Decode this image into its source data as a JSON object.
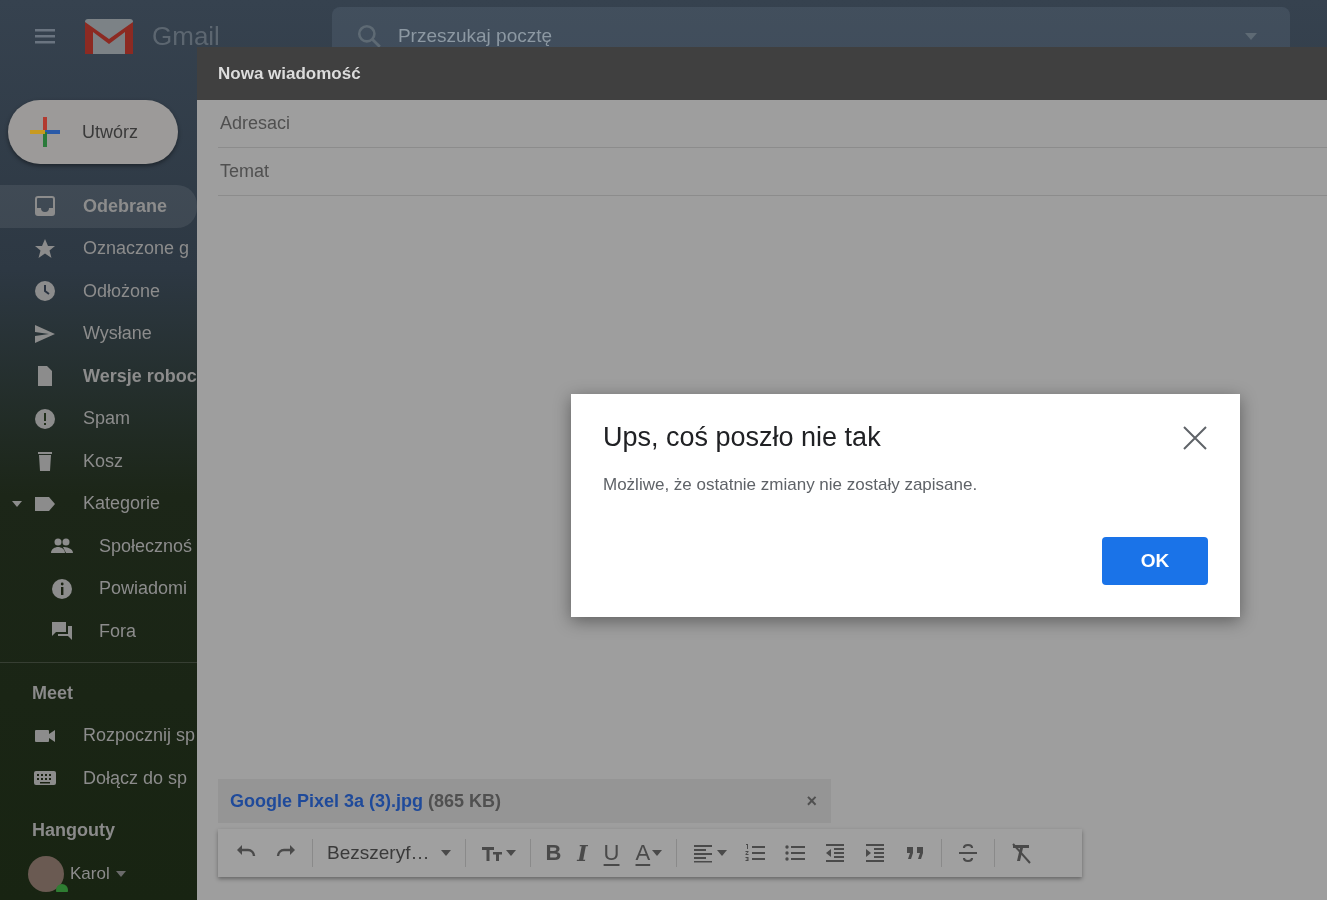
{
  "topbar": {
    "app_name": "Gmail",
    "search": {
      "placeholder": "Przeszukaj pocztę"
    }
  },
  "compose_button": {
    "label": "Utwórz"
  },
  "sidebar": {
    "items": [
      {
        "label": "Odebrane",
        "selected": true,
        "unread": true
      },
      {
        "label": "Oznaczone g",
        "selected": false,
        "unread": false
      },
      {
        "label": "Odłożone",
        "selected": false,
        "unread": false
      },
      {
        "label": "Wysłane",
        "selected": false,
        "unread": false
      },
      {
        "label": "Wersje roboc",
        "selected": false,
        "unread": true
      },
      {
        "label": "Spam",
        "selected": false,
        "unread": false
      },
      {
        "label": "Kosz",
        "selected": false,
        "unread": false
      },
      {
        "label": "Kategorie",
        "selected": false,
        "unread": false,
        "expanded": true,
        "children": [
          {
            "label": "Społecznoś",
            "selected": false,
            "unread": false
          },
          {
            "label": "Powiadomi",
            "selected": false,
            "unread": false
          },
          {
            "label": "Fora",
            "selected": false,
            "unread": false
          }
        ]
      }
    ]
  },
  "meet": {
    "title": "Meet",
    "items": [
      {
        "label": "Rozpocznij sp"
      },
      {
        "label": "Dołącz do sp"
      }
    ]
  },
  "hangouts": {
    "title": "Hangouty",
    "user": {
      "name": "Karol",
      "online": true
    }
  },
  "compose": {
    "title": "Nowa wiadomość",
    "to_placeholder": "Adresaci",
    "subject_placeholder": "Temat",
    "attachment": {
      "name": "Google Pixel 3a (3).jpg",
      "size": "(865 KB)",
      "remove": "×"
    },
    "toolbar": [
      {
        "kind": "icon"
      },
      {
        "kind": "icon"
      },
      {
        "kind": "sep"
      },
      {
        "kind": "select",
        "label": "Bezszeryf…"
      },
      {
        "kind": "sep"
      },
      {
        "kind": "icon",
        "caret": true
      },
      {
        "kind": "sep"
      },
      {
        "kind": "bold",
        "label": "B"
      },
      {
        "kind": "italic",
        "label": "I"
      },
      {
        "kind": "underline",
        "label": "U"
      },
      {
        "kind": "color",
        "label": "A",
        "caret": true
      },
      {
        "kind": "sep"
      },
      {
        "kind": "icon",
        "caret": true
      },
      {
        "kind": "icon"
      },
      {
        "kind": "icon"
      },
      {
        "kind": "icon"
      },
      {
        "kind": "icon"
      },
      {
        "kind": "icon"
      },
      {
        "kind": "sep"
      },
      {
        "kind": "icon"
      },
      {
        "kind": "sep"
      },
      {
        "kind": "icon"
      }
    ]
  },
  "dialog": {
    "title": "Ups, coś poszło nie tak",
    "message": "Możliwe, że ostatnie zmiany nie zostały zapisane.",
    "ok": "OK"
  }
}
